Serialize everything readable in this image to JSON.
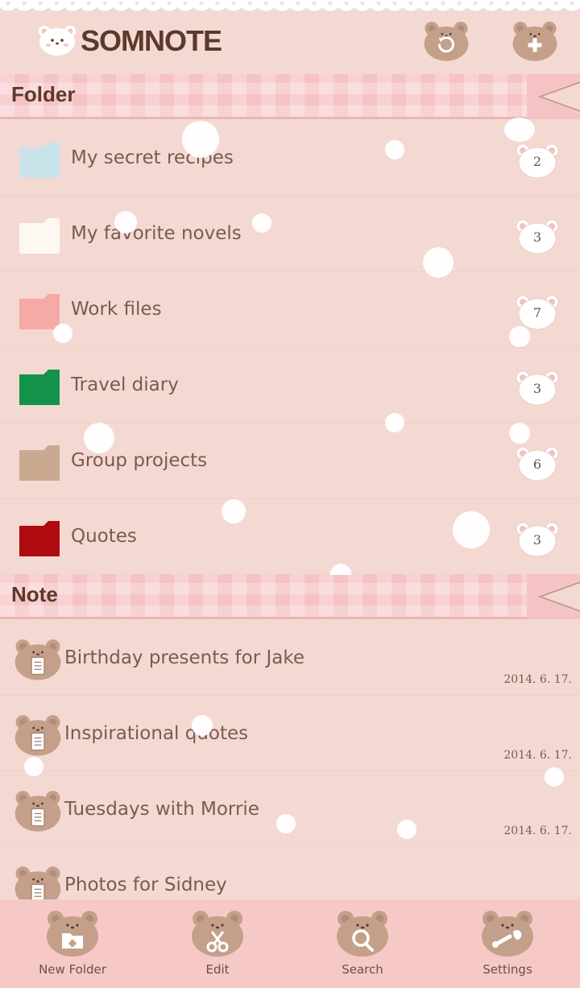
{
  "app": {
    "title": "SOMNOTE"
  },
  "sections": {
    "folder_label": "Folder",
    "note_label": "Note"
  },
  "folders": [
    {
      "name": "My secret recipes",
      "count": "2",
      "color": "#c9e3ea"
    },
    {
      "name": "My favorite novels",
      "count": "3",
      "color": "#fdf8f2"
    },
    {
      "name": "Work files",
      "count": "7",
      "color": "#f5aaa6"
    },
    {
      "name": "Travel diary",
      "count": "3",
      "color": "#13924a"
    },
    {
      "name": "Group projects",
      "count": "6",
      "color": "#c9a98f"
    },
    {
      "name": "Quotes",
      "count": "3",
      "color": "#ae0a0f"
    }
  ],
  "notes": [
    {
      "title": "Birthday presents for Jake",
      "date": "2014. 6. 17."
    },
    {
      "title": "Inspirational quotes",
      "date": "2014. 6. 17."
    },
    {
      "title": "Tuesdays with Morrie",
      "date": "2014. 6. 17."
    },
    {
      "title": "Photos for Sidney",
      "date": ""
    }
  ],
  "bottom_bar": {
    "new_folder": "New Folder",
    "edit": "Edit",
    "search": "Search",
    "settings": "Settings"
  },
  "colors": {
    "background": "#f4d9d3",
    "ribbon": "#f6c3c4",
    "bottom_bar": "#f6c9c7",
    "bear_brown": "#c4a08a",
    "title_text": "#5a3a2a"
  }
}
